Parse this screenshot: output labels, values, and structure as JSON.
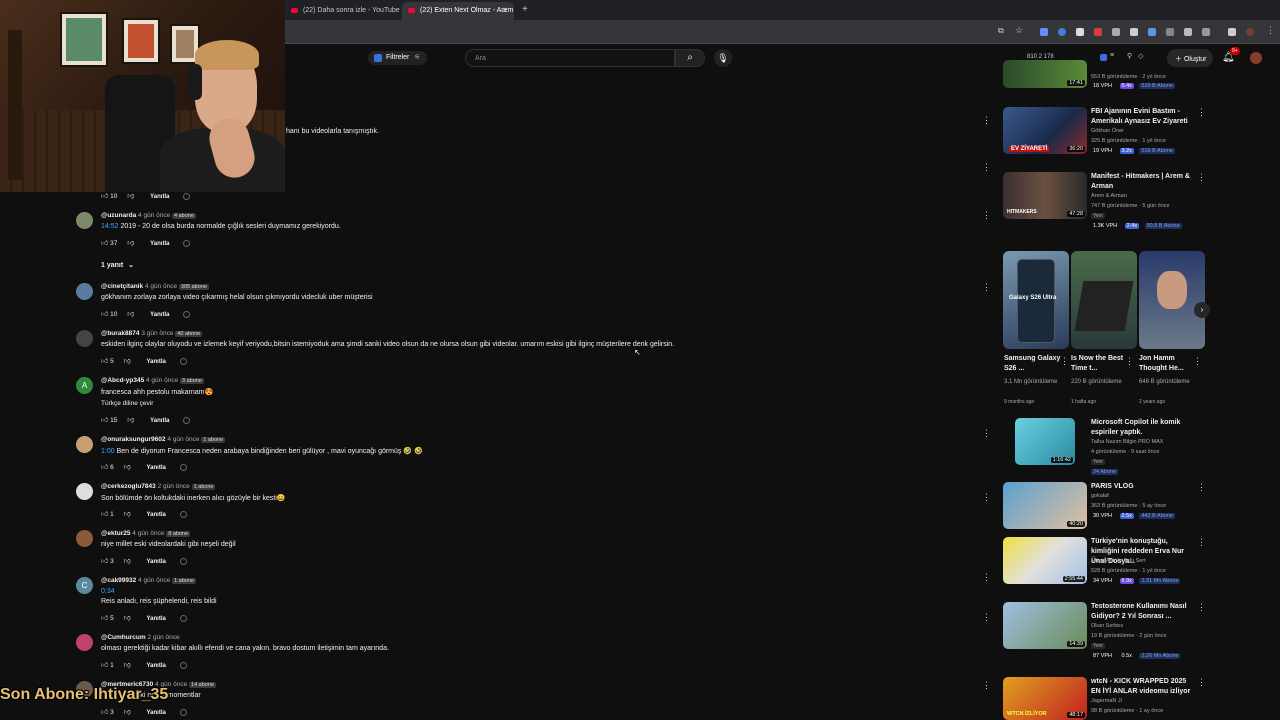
{
  "browser": {
    "tabs": [
      {
        "label": "(22) Daha sonra izle - YouTube",
        "active": false
      },
      {
        "label": "(22) Exten Next Olmaz - Arem",
        "active": true
      }
    ],
    "new_tab": "+"
  },
  "header": {
    "filter_label": "Filtreler",
    "search_placeholder": "Ara",
    "stats": "810   2   178",
    "create_label": "Oluştur",
    "notification_count": "9+"
  },
  "comments": {
    "top_snippet": "hanı bu videolarla tanışmıştık.",
    "first_actions": {
      "likes": "10",
      "reply": "Yanıtla"
    },
    "replies_toggle": "1 yanıt",
    "items": [
      {
        "user": "@uzunarda",
        "time": "4 gün önce",
        "subs": "4 abone",
        "timestamp": "14:52",
        "text": "2019 - 20 de olsa burda normalde çığlık sesleri duymamız gerekiyordu.",
        "likes": "37",
        "reply": "Yanıtla",
        "avatar_color": "#7a8a6a"
      },
      {
        "user": "@cinetçitanik",
        "time": "4 gün önce",
        "subs": "305 abone",
        "text": "gökhanım zorlaya zorlaya video çıkarmış helal olsun çıkmıyordu videcluk uber müşterisi",
        "likes": "10",
        "reply": "Yanıtla",
        "avatar_color": "#5a7aa0"
      },
      {
        "user": "@burak8874",
        "time": "3 gün önce",
        "subs": "40 abone",
        "text": "eskiden ilginç olaylar oluyodu ve izlemek keyif veriyodu,bitsin istemiyoduk ama şimdi sanki video olsun da ne olursa olsun gibi videolar. umarım eskisi gibi ilginç müşterilere denk gelirsin.",
        "likes": "5",
        "reply": "Yanıtla",
        "avatar_color": "#444"
      },
      {
        "user": "@Abcd-yp345",
        "time": "4 gün önce",
        "subs": "3 abone",
        "text": "francesca ahh pestolu makarnam😍",
        "translate": "Türkçe diline çevir",
        "likes": "15",
        "reply": "Yanıtla",
        "avatar_color": "#2e8b3e",
        "avatar_letter": "A"
      },
      {
        "user": "@onuraksungur9602",
        "time": "4 gün önce",
        "subs": "1 abone",
        "timestamp": "1:00",
        "text": "Ben de diyorum Francesca neden arabaya bindiğinden beri gülüyor , mavi oyuncağı görmüş 🤣 🤣",
        "likes": "6",
        "reply": "Yanıtla",
        "avatar_color": "#c8a070"
      },
      {
        "user": "@cerkezoglu7843",
        "time": "2 gün önce",
        "subs": "1 abone",
        "text": "Son bölümde ön koltukdaki inerken alıcı gözüyle bir kesti😄",
        "likes": "1",
        "reply": "Yanıtla",
        "avatar_color": "#ddd"
      },
      {
        "user": "@ektur25",
        "time": "4 gün önce",
        "subs": "8 abone",
        "text": "niye millet eski videolardaki gibi neşeli değil",
        "likes": "3",
        "reply": "Yanıtla",
        "avatar_color": "#8a5a3a"
      },
      {
        "user": "@cak99932",
        "time": "4 gün önce",
        "subs": "1 abone",
        "timestamp_line": "0:34",
        "text": "Reis anladı, reis şüphelendi, reis bildi",
        "likes": "5",
        "reply": "Yanıtla",
        "avatar_color": "#5a8aa0",
        "avatar_letter": "C"
      },
      {
        "user": "@Cumhurcum",
        "time": "2 gün önce",
        "text": "olması gerektiği kadar kibar akıllı efendi ve cana yakın. bravo dostum iletişimin tam ayarında.",
        "likes": "1",
        "reply": "Yanıtla",
        "avatar_color": "#c04070"
      },
      {
        "user": "@mertmeric6730",
        "time": "4 gün önce",
        "subs": "14 abone",
        "text": "eski neşeli momentlar",
        "likes": "3",
        "reply": "Yanıtla",
        "avatar_color": "#6a5a4a"
      }
    ]
  },
  "overlay": {
    "text": "Son Abone: Ihtiyar_35"
  },
  "sidebar": {
    "top_partial": {
      "duration": "17:41",
      "views": "553 B görüntüleme · 2 yıl önce",
      "vph": "18 VPH",
      "mult": "5.4x",
      "subs": "519 B Abone"
    },
    "videos": [
      {
        "title": "FBI Ajanının Evini Bastım - Amerikalı Aynasız Ev Ziyareti",
        "channel": "Gökhan Öner",
        "views": "325 B görüntüleme · 1 yıl önce",
        "duration": "36:20",
        "thumb_text": "EV ZİYARETİ",
        "vph": "19 VPH",
        "mult": "3.2x",
        "subs": "519 B Abone"
      },
      {
        "title": "Manifest - Hitmakers | Arem & Arman",
        "channel": "Arem & Arman",
        "views": "747 B görüntüleme · 5 gün önce",
        "new": "Yeni",
        "duration": "47:28",
        "thumb_text": "HITMAKERS",
        "vph": "1.3K VPH",
        "mult": "2.4x",
        "subs": "90,8 B Abone"
      },
      {
        "title": "Microsoft Copilot  ile komik espiriler yaptık.",
        "channel": "Talha Nazım Bilgin PRO MAX",
        "views": "4 görüntüleme · 9 saat önce",
        "new": "Yeni",
        "duration": "1:16:42",
        "subs_only": "24 Abone"
      },
      {
        "title": "PARIS VLOG",
        "channel": "gokalaf",
        "views": "363 B görüntüleme · 5 ay önce",
        "duration": "40:20",
        "vph": "30 VPH",
        "mult": "2.5x",
        "subs": "442 B Abone"
      },
      {
        "title": "Türkiye'nin konuştuğu, kimliğini reddeden Erva Nur Ünal Dosya...",
        "channel": "Müge Anlı ile Tatlı Sert",
        "views": "528 B görüntüleme · 1 yıl önce",
        "duration": "2:55:44",
        "vph": "34 VPH",
        "mult": "6.9x",
        "subs": "3,31 Mn Abone"
      },
      {
        "title": "Testosterone Kullanımı Nasıl Gidiyor? 2 Yıl Sonrası ...",
        "channel": "Okan Serbes",
        "views": "19 B görüntüleme · 2 gün önce",
        "new": "Yeni",
        "duration": "14:39",
        "vph": "87 VPH",
        "mult": "0.5x",
        "subs": "2,26 Mn Abone"
      },
      {
        "title": "wtcN - KICK WRAPPED 2025 EN İYİ ANLAR videomu izliyor",
        "channel": "JagermaN Ji",
        "views": "98 B görüntüleme · 1 ay önce",
        "duration": "48:17",
        "thumb_text": "WTCN İZLİYOR"
      }
    ],
    "shorts": [
      {
        "title": "Samsung Galaxy S26 ...",
        "views": "3,1 Mn görüntüleme",
        "ago": "9 months ago",
        "thumb_text": "Galaxy S26 Ultra"
      },
      {
        "title": "Is Now the Best Time t...",
        "views": "220 B görüntüleme",
        "ago": "1 hafta ago"
      },
      {
        "title": "Jon Hamm Thought He...",
        "views": "646 B görüntüleme",
        "ago": "2 years ago"
      }
    ]
  }
}
